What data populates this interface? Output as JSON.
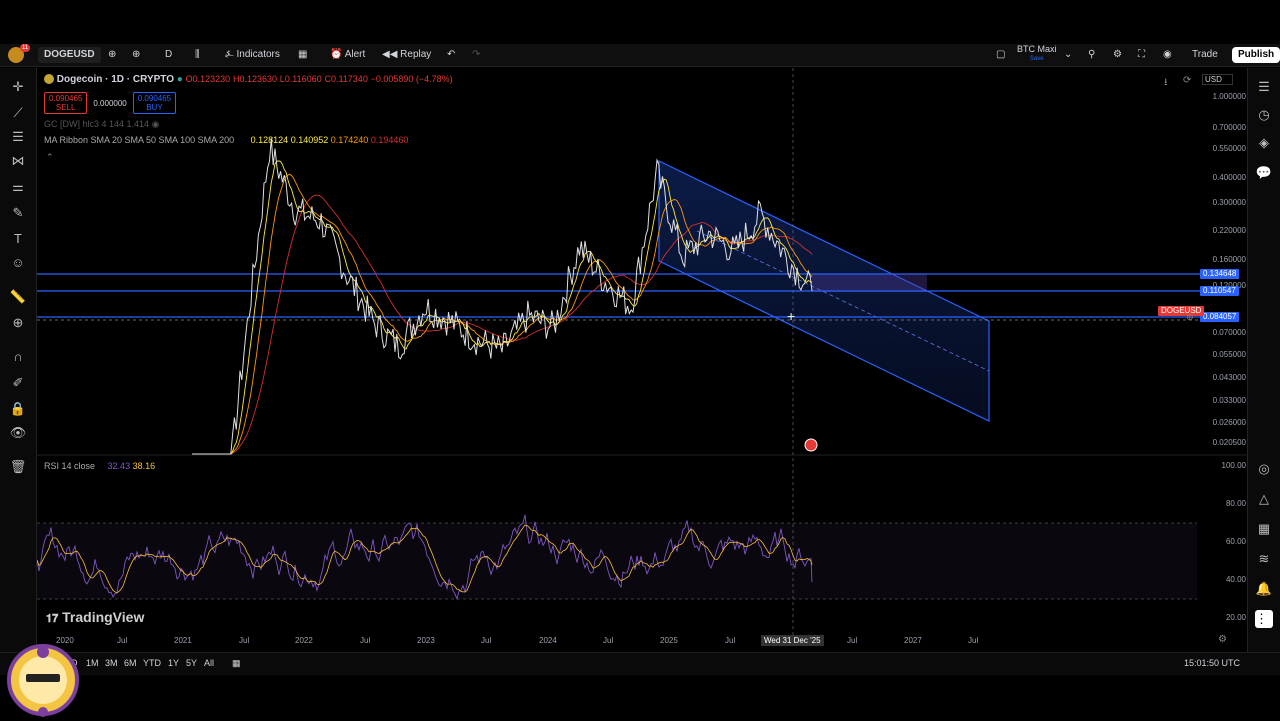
{
  "top_toolbar": {
    "symbol": "DOGEUSD",
    "interval": "D",
    "indicators_label": "Indicators",
    "alert_label": "Alert",
    "replay_label": "Replay",
    "layout_name": "BTC Maxi",
    "layout_sub": "Save",
    "trade_label": "Trade",
    "publish_label": "Publish",
    "avatar_badge": "11"
  },
  "legend": {
    "title": "Dogecoin · 1D · CRYPTO",
    "ohlc": {
      "open": "O0.123230",
      "high": "H0.123630",
      "low": "L0.116060",
      "close": "C0.117340",
      "change": "−0.005890 (−4.78%)"
    },
    "sell_price": "0.090465",
    "sell_label": "SELL",
    "spread": "0.000000",
    "buy_price": "0.090465",
    "buy_label": "BUY",
    "indicator_line": "GC [DW] hlc3 4 144 1.414",
    "ma_label": "MA Ribbon SMA 20 SMA 50 SMA 100 SMA 200",
    "ma_values": [
      "0.128124",
      "0.140952",
      "0.174240",
      "0.194460"
    ]
  },
  "price_axis": {
    "currency": "USD",
    "ticks": [
      "1.000000",
      "0.700000",
      "0.550000",
      "0.400000",
      "0.300000",
      "0.220000",
      "0.160000",
      "0.120000",
      "0.070000",
      "0.055000",
      "0.043000",
      "0.033000",
      "0.026000",
      "0.020500"
    ],
    "line_labels": [
      "0.134648",
      "0.110547",
      "0.084057"
    ],
    "symbol_tag": "DOGEUSD",
    "colors": {
      "level_tag": "#2962ff",
      "symbol_tag": "#e53935"
    }
  },
  "rsi": {
    "label": "RSI 14 close",
    "value1": "32.43",
    "value2": "38.16",
    "ticks": [
      "100.00",
      "80.00",
      "60.00",
      "40.00",
      "20.00"
    ]
  },
  "time_axis": {
    "labels": [
      "2020",
      "Jul",
      "2021",
      "Jul",
      "2022",
      "Jul",
      "2023",
      "Jul",
      "2024",
      "Jul",
      "2025",
      "Jul",
      "Jul",
      "2027",
      "Jul"
    ],
    "crosshair_date": "Wed 31 Dec '25"
  },
  "bottom_bar": {
    "ranges": [
      "1D",
      "1M",
      "3M",
      "6M",
      "YTD",
      "1Y",
      "5Y",
      "All"
    ],
    "clock": "15:01:50 UTC"
  },
  "watermark": "TradingView",
  "chart_data": {
    "type": "line",
    "title": "Dogecoin · 1D · CRYPTO",
    "xlabel": "",
    "ylabel": "",
    "y_scale": "log",
    "ylim": [
      0.0205,
      1.0
    ],
    "x": [
      "2020-10",
      "2021-01",
      "2021-03",
      "2021-05",
      "2021-08",
      "2021-11",
      "2022-02",
      "2022-05",
      "2022-08",
      "2022-11",
      "2023-02",
      "2023-05",
      "2023-08",
      "2023-11",
      "2024-02",
      "2024-03",
      "2024-06",
      "2024-09",
      "2024-12",
      "2025-03",
      "2025-05",
      "2025-07",
      "2025-09",
      "2025-11",
      "2025-12"
    ],
    "series": [
      {
        "values": [
          0.0025,
          0.0056,
          0.06,
          0.55,
          0.28,
          0.25,
          0.14,
          0.085,
          0.065,
          0.1,
          0.085,
          0.07,
          0.062,
          0.09,
          0.08,
          0.19,
          0.13,
          0.1,
          0.42,
          0.17,
          0.22,
          0.18,
          0.27,
          0.17,
          0.118
        ]
      }
    ],
    "horizontal_levels": [
      0.134648,
      0.110547,
      0.084057
    ],
    "rsi_series": {
      "name": "RSI 14 close",
      "ylim": [
        0,
        100
      ],
      "bands": [
        30,
        70
      ],
      "last_value": 32.43
    }
  }
}
